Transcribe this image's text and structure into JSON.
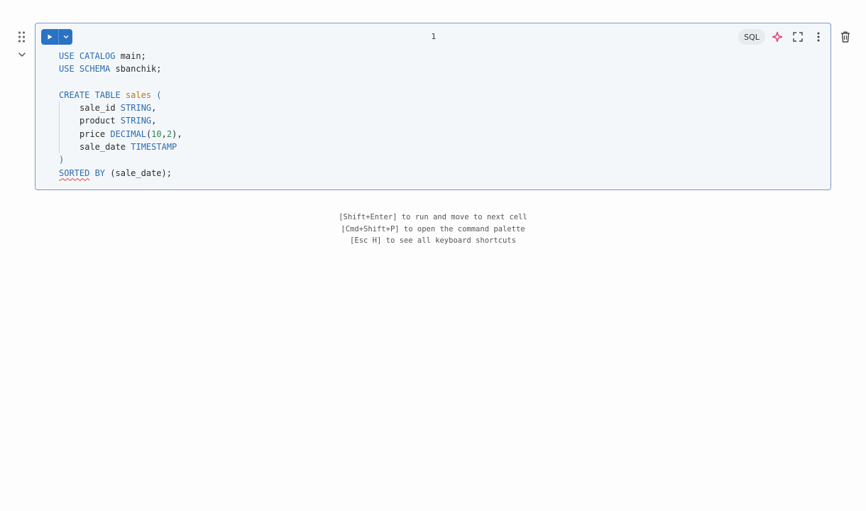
{
  "cell": {
    "number": "1",
    "language": "SQL",
    "code_lines": [
      {
        "indent": 0,
        "tokens": [
          {
            "t": "USE CATALOG",
            "c": "kw"
          },
          {
            "t": " main;",
            "c": ""
          }
        ]
      },
      {
        "indent": 0,
        "tokens": [
          {
            "t": "USE SCHEMA",
            "c": "kw"
          },
          {
            "t": " sbanchik;",
            "c": ""
          }
        ]
      },
      {
        "indent": 0,
        "tokens": []
      },
      {
        "indent": 0,
        "tokens": [
          {
            "t": "CREATE TABLE",
            "c": "kw"
          },
          {
            "t": " ",
            "c": ""
          },
          {
            "t": "sales",
            "c": "fn"
          },
          {
            "t": " (",
            "c": "kw"
          }
        ]
      },
      {
        "indent": 1,
        "tokens": [
          {
            "t": "sale_id ",
            "c": ""
          },
          {
            "t": "STRING",
            "c": "kw"
          },
          {
            "t": ",",
            "c": ""
          }
        ]
      },
      {
        "indent": 1,
        "tokens": [
          {
            "t": "product ",
            "c": ""
          },
          {
            "t": "STRING",
            "c": "kw"
          },
          {
            "t": ",",
            "c": ""
          }
        ]
      },
      {
        "indent": 1,
        "tokens": [
          {
            "t": "price ",
            "c": ""
          },
          {
            "t": "DECIMAL",
            "c": "kw"
          },
          {
            "t": "(",
            "c": ""
          },
          {
            "t": "10",
            "c": "num"
          },
          {
            "t": ",",
            "c": ""
          },
          {
            "t": "2",
            "c": "num"
          },
          {
            "t": "),",
            "c": ""
          }
        ]
      },
      {
        "indent": 1,
        "tokens": [
          {
            "t": "sale_date ",
            "c": ""
          },
          {
            "t": "TIMESTAMP",
            "c": "kw"
          }
        ]
      },
      {
        "indent": 0,
        "tokens": [
          {
            "t": ")",
            "c": "kw"
          }
        ]
      },
      {
        "indent": 0,
        "tokens": [
          {
            "t": "SORTED",
            "c": "kw squiggle"
          },
          {
            "t": " BY",
            "c": "kw"
          },
          {
            "t": " (sale_date);",
            "c": ""
          }
        ]
      }
    ]
  },
  "hints": [
    "[Shift+Enter] to run and move to next cell",
    "[Cmd+Shift+P] to open the command palette",
    "[Esc H] to see all keyboard shortcuts"
  ],
  "icons": {
    "drag": "drag-handle-icon",
    "collapse": "chevron-down-icon",
    "run": "play-icon",
    "run_menu": "chevron-down-icon",
    "assistant": "sparkle-icon",
    "fullscreen": "expand-icon",
    "more": "kebab-menu-icon",
    "delete": "trash-icon"
  },
  "colors": {
    "accent": "#2a72c4",
    "cell_border": "#7a99c4",
    "keyword": "#2b6cb0",
    "identifier": "#b07b1e",
    "number": "#2a8a4a",
    "assistant_icon": "#e0447a",
    "error_squiggle": "#e0443a"
  }
}
